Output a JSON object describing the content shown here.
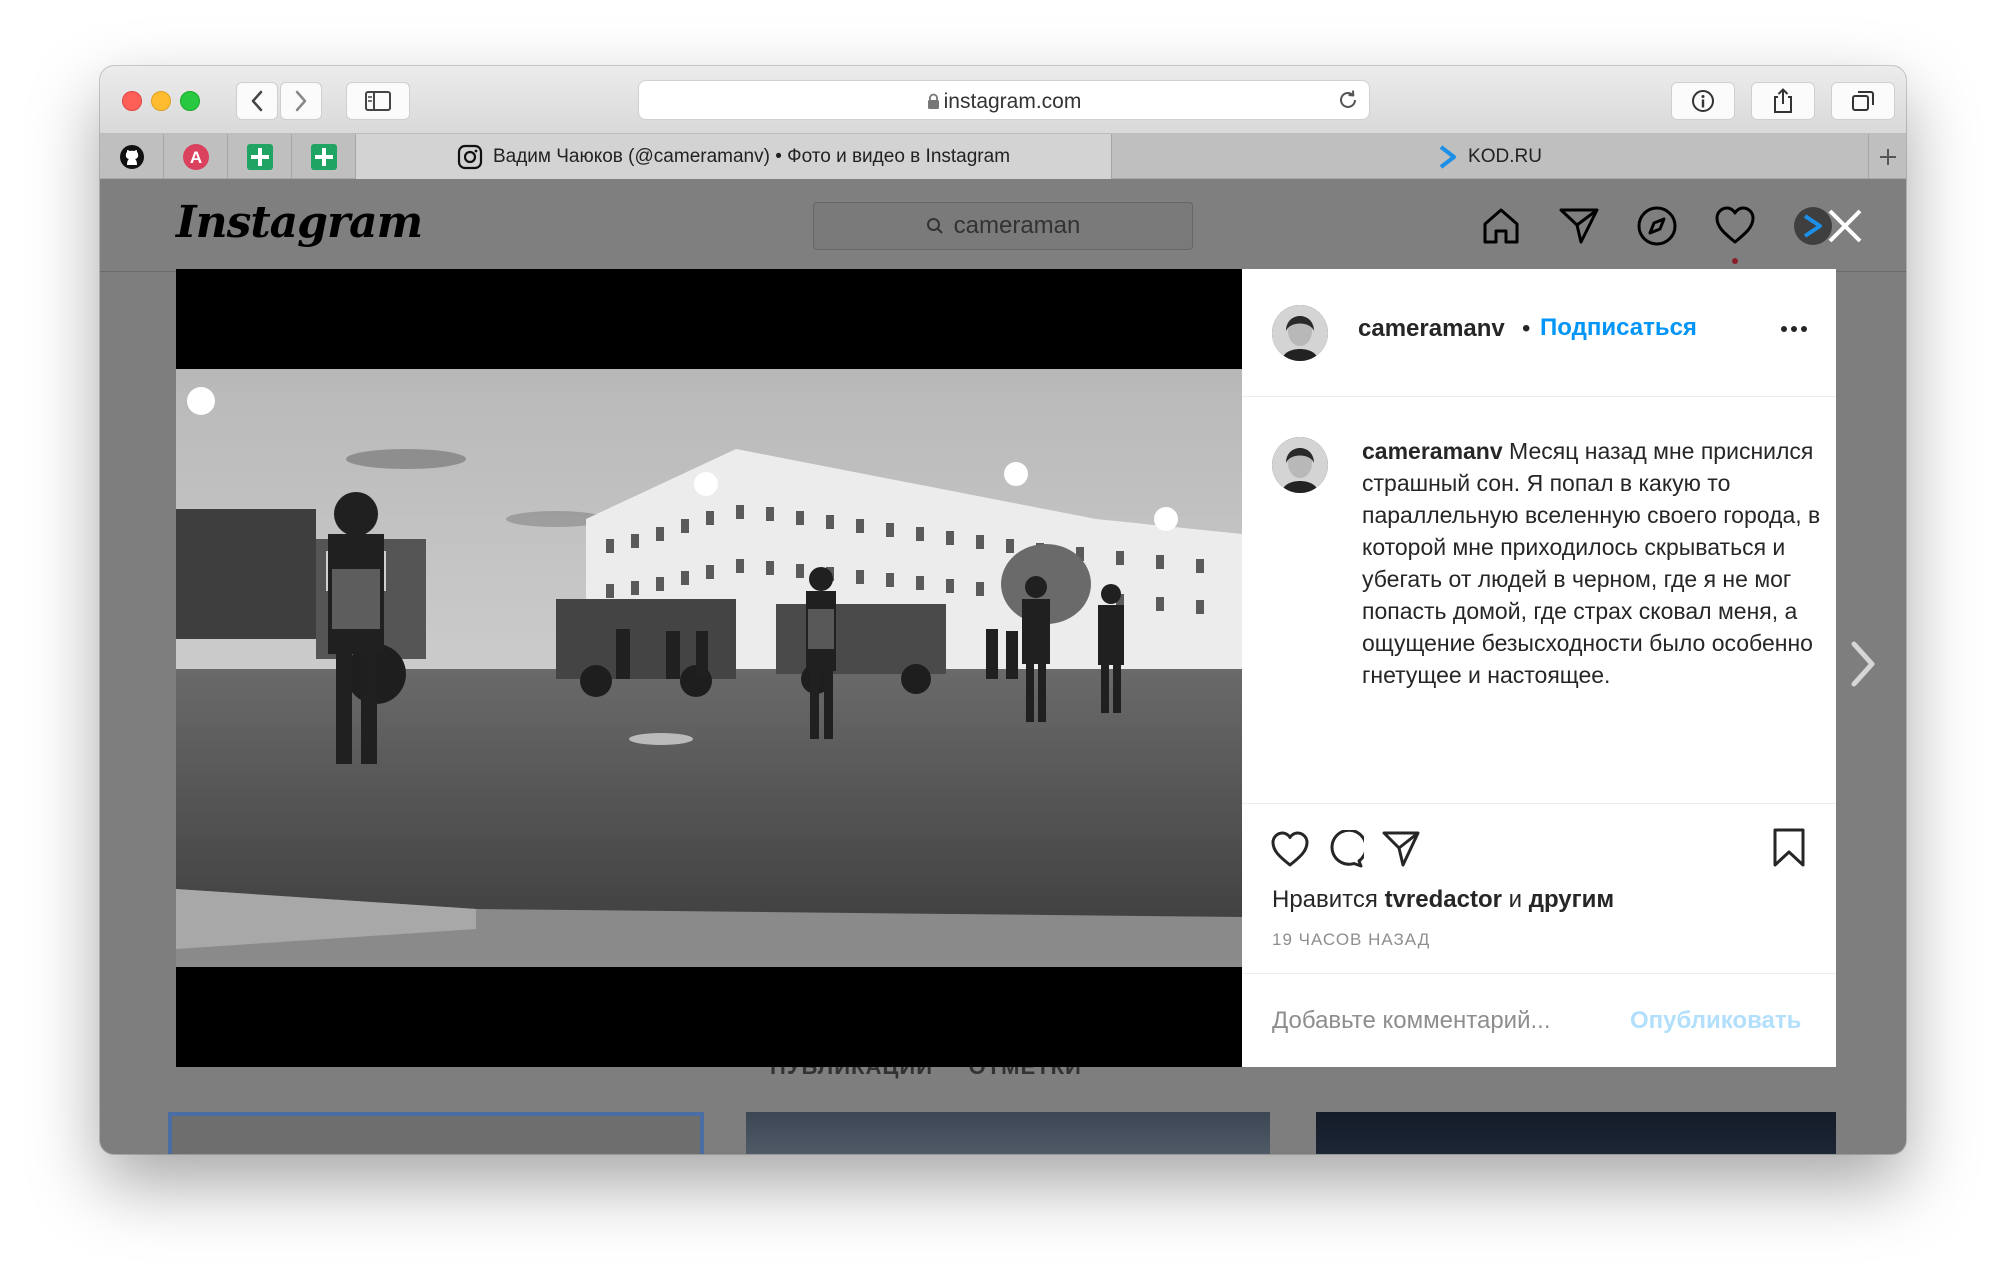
{
  "browser": {
    "address": "instagram.com",
    "tabs": [
      {
        "title": "Вадим Чаюков (@cameramanv) • Фото и видео в Instagram",
        "active": true
      },
      {
        "title": "KOD.RU",
        "active": false
      }
    ],
    "pinned_tabs": [
      "github-icon",
      "a-letter-icon",
      "green-plus-icon",
      "green-plus-icon"
    ]
  },
  "instagram": {
    "logo": "Instagram",
    "search_text": "cameraman",
    "nav_icons": [
      "home-icon",
      "direct-icon",
      "explore-icon",
      "activity-heart-icon",
      "profile-avatar-icon"
    ]
  },
  "post": {
    "username": "cameramanv",
    "separator": "•",
    "follow_label": "Подписаться",
    "caption": "Месяц назад мне приснился страшный сон. Я попал в какую то параллельную вселенную своего города, в которой мне приходилось скрываться и убегать от людей в черном, где я не мог попасть домой, где страх сковал меня, а ощущение безысходности было особенно гнетущее и настоящее.",
    "likes_prefix": "Нравится ",
    "likes_user": "tvredactor",
    "likes_and": " и ",
    "likes_others": "другим",
    "time_ago": "19 ЧАСОВ НАЗАД",
    "comment_placeholder": "Добавьте комментарий...",
    "publish_label": "Опубликовать"
  },
  "profile_tabs": "ПУБЛИКАЦИИ     ОТМЕТКИ",
  "colors": {
    "link_blue": "#0095f6",
    "publish_disabled": "#b2dffc",
    "overlay": "#7f7f7f"
  }
}
